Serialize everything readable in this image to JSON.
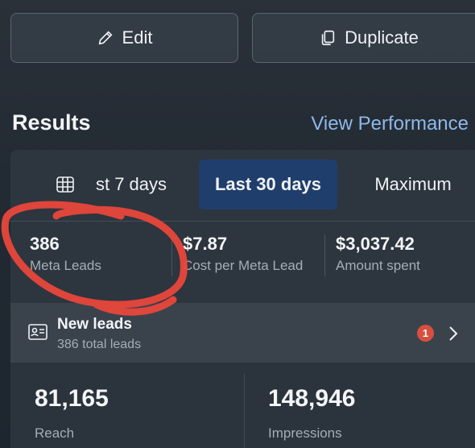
{
  "actions": {
    "edit_label": "Edit",
    "duplicate_label": "Duplicate"
  },
  "results": {
    "title": "Results",
    "view_performance": "View Performance"
  },
  "date_ranges": [
    {
      "label": "st 7 days",
      "selected": false
    },
    {
      "label": "Last 30 days",
      "selected": true
    },
    {
      "label": "Maximum",
      "selected": false
    }
  ],
  "metrics": [
    {
      "value": "386",
      "label": "Meta Leads"
    },
    {
      "value": "$7.87",
      "label": "Cost per Meta Lead"
    },
    {
      "value": "$3,037.42",
      "label": "Amount spent"
    }
  ],
  "leads": {
    "title": "New leads",
    "subtitle": "386 total leads",
    "badge": "1"
  },
  "stats": [
    {
      "value": "81,165",
      "label": "Reach"
    },
    {
      "value": "148,946",
      "label": "Impressions"
    }
  ],
  "colors": {
    "selected_tab": "#203e6c",
    "link": "#8fb8e8",
    "badge": "#d7503f",
    "annotation": "#e8473b"
  }
}
